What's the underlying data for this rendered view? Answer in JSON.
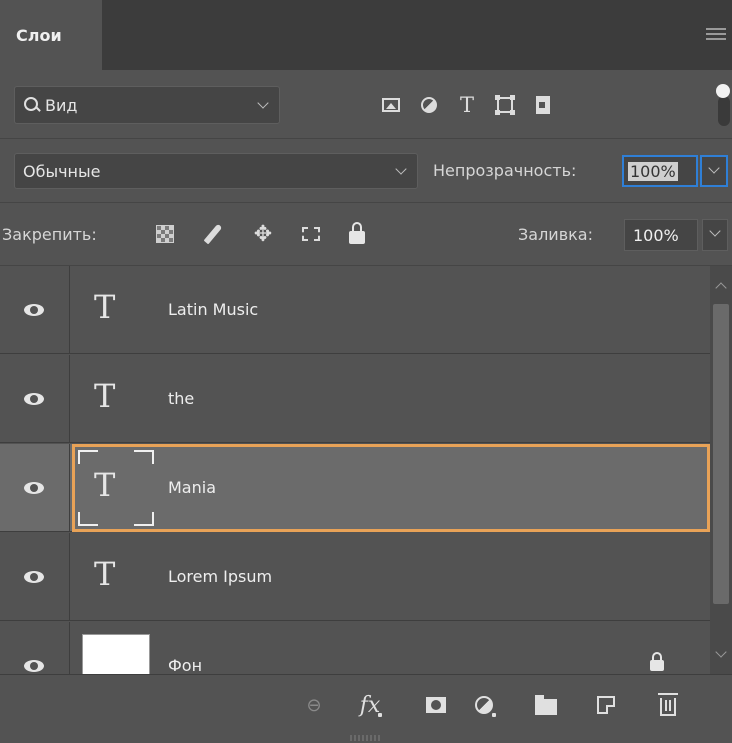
{
  "panel": {
    "tab_label": "Слои"
  },
  "filter": {
    "kind_label": "Вид"
  },
  "blend": {
    "mode": "Обычные",
    "opacity_label": "Непрозрачность:",
    "opacity_value": "100%"
  },
  "lock": {
    "label": "Закрепить:",
    "fill_label": "Заливка:",
    "fill_value": "100%"
  },
  "layers": [
    {
      "name": "Latin Music",
      "type": "text",
      "visible": true,
      "selected": false
    },
    {
      "name": "the",
      "type": "text",
      "visible": true,
      "selected": false
    },
    {
      "name": "Mania",
      "type": "text",
      "visible": true,
      "selected": true
    },
    {
      "name": "Lorem Ipsum",
      "type": "text",
      "visible": true,
      "selected": false
    },
    {
      "name": "Фон",
      "type": "background",
      "visible": true,
      "selected": false,
      "locked": true
    }
  ],
  "colors": {
    "panel_bg": "#535353",
    "selected_border": "#e8a257",
    "focus_blue": "#2f7fd6"
  },
  "icons": {
    "filter_kinds": [
      "pixel-layer-filter-icon",
      "adjustment-layer-filter-icon",
      "type-layer-filter-icon",
      "shape-layer-filter-icon",
      "smart-object-filter-icon"
    ],
    "locks": [
      "lock-pixels-icon",
      "lock-image-pixels-brush-icon",
      "lock-position-move-icon",
      "lock-artboard-icon",
      "lock-all-icon"
    ],
    "toolbar": [
      "link-layers-icon",
      "fx-icon",
      "add-mask-icon",
      "adjustment-layer-icon",
      "new-group-folder-icon",
      "new-layer-icon",
      "trash-icon"
    ]
  }
}
